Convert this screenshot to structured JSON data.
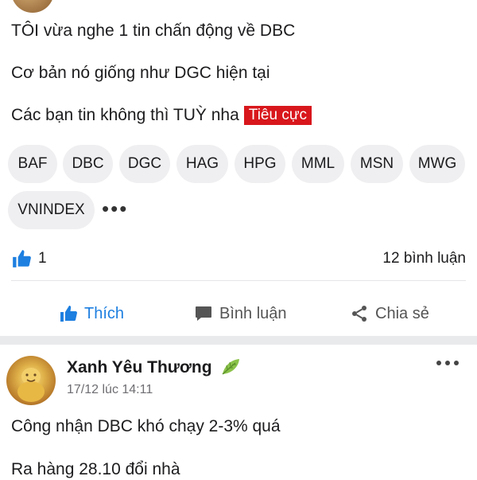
{
  "post1": {
    "lines": [
      "TÔI vừa nghe 1 tin chấn động về DBC",
      "Cơ bản nó giống như DGC hiện tại",
      "Các bạn tin không thì TUỲ nha"
    ],
    "sentiment_label": "Tiêu cực",
    "tags": [
      "BAF",
      "DBC",
      "DGC",
      "HAG",
      "HPG",
      "MML",
      "MSN",
      "MWG",
      "VNINDEX"
    ],
    "like_count": "1",
    "comment_count": "12 bình luận",
    "actions": {
      "like": "Thích",
      "comment": "Bình luận",
      "share": "Chia sẻ"
    }
  },
  "post2": {
    "author": "Xanh Yêu Thương",
    "timestamp": "17/12 lúc 14:11",
    "lines": [
      "Công nhận DBC khó chạy 2-3% quá",
      "Ra hàng 28.10 đổi nhà"
    ]
  },
  "colors": {
    "accent": "#1d7fe0",
    "negative_tag": "#d8171c",
    "tag_bg": "#efeff1",
    "separator": "#e9eaec"
  },
  "icons": {
    "like": "thumbs-up-icon",
    "comment": "comment-bubble-icon",
    "share": "share-icon",
    "more": "more-horizontal-icon",
    "badge": "leaf-icon"
  }
}
